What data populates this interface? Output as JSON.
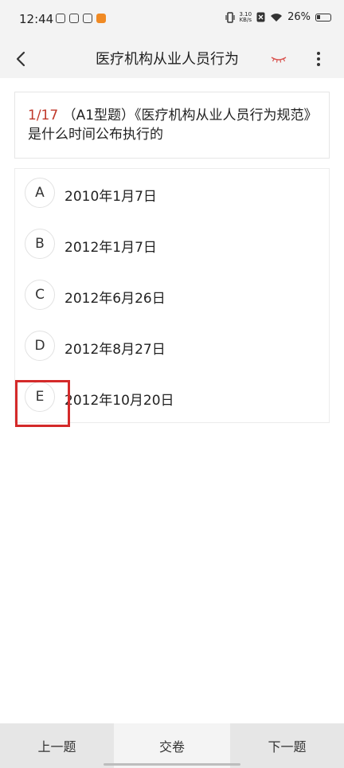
{
  "status_bar": {
    "time": "12:44",
    "net_speed_value": "3.10",
    "net_speed_unit": "KB/s",
    "battery": "26%"
  },
  "header": {
    "title": "医疗机构从业人员行为"
  },
  "question": {
    "index": "1/17",
    "text": " （A1型题）《医疗机构从业人员行为规范》是什么时间公布执行的"
  },
  "options": [
    {
      "letter": "A",
      "text": "2010年1月7日"
    },
    {
      "letter": "B",
      "text": "2012年1月7日"
    },
    {
      "letter": "C",
      "text": "2012年6月26日"
    },
    {
      "letter": "D",
      "text": "2012年8月27日"
    },
    {
      "letter": "E",
      "text": "2012年10月20日"
    }
  ],
  "bottom_bar": {
    "prev_label": "上一题",
    "submit_label": "交卷",
    "next_label": "下一题"
  },
  "colors": {
    "accent_red": "#c0392b",
    "highlight_red": "#d42a2a"
  }
}
